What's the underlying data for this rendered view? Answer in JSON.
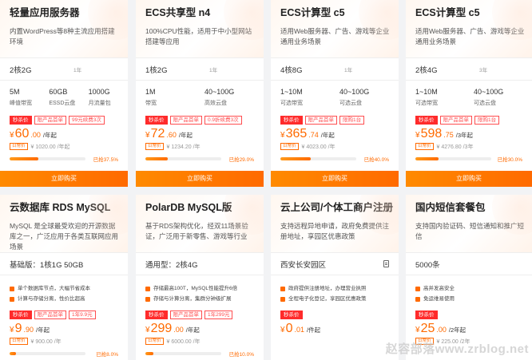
{
  "cards_row1": [
    {
      "title": "轻量应用服务器",
      "desc": "内置WordPress等8种主流应用搭建环境",
      "spec": "2核2G",
      "spec_sub": "1年",
      "metrics": [
        {
          "v": "5M",
          "l": "峰值带宽"
        },
        {
          "v": "60GB",
          "l": "ESSD云盘"
        },
        {
          "v": "1000G",
          "l": "月流量包"
        }
      ],
      "tags": [
        {
          "t": "秒杀价",
          "s": "solid"
        },
        {
          "t": "限产品首单",
          "s": "red"
        },
        {
          "t": "99元续费3次",
          "s": "red"
        }
      ],
      "price": {
        "sym": "¥",
        "num": "60",
        "dec": ".00",
        "unit": "/年起"
      },
      "daily": "日常价",
      "orig": "¥ 1020.00 /年起",
      "progress": 37.5,
      "sold": "已抢37.5%",
      "buy": "立即购买"
    },
    {
      "title": "ECS共享型 n4",
      "desc": "100%CPU性能，适用于中小型网站搭建等应用",
      "spec": "1核2G",
      "spec_sub": "1年",
      "metrics": [
        {
          "v": "1M",
          "l": "带宽"
        },
        {
          "v": "40~100G",
          "l": "高效云盘"
        }
      ],
      "tags": [
        {
          "t": "秒杀价",
          "s": "solid"
        },
        {
          "t": "限产品首单",
          "s": "red"
        },
        {
          "t": "0.9折续费3次",
          "s": "red"
        }
      ],
      "price": {
        "sym": "¥",
        "num": "72",
        "dec": ".60",
        "unit": "/年起"
      },
      "daily": "日常价",
      "orig": "¥ 1234.20 /年",
      "progress": 29.0,
      "sold": "已抢29.0%",
      "buy": "立即购买"
    },
    {
      "title": "ECS计算型 c5",
      "desc": "适用Web服务器、广告、游戏等企业通用业务场景",
      "spec": "4核8G",
      "spec_sub": "1年",
      "metrics": [
        {
          "v": "1~10M",
          "l": "可选带宽"
        },
        {
          "v": "40~100G",
          "l": "可选云盘"
        }
      ],
      "tags": [
        {
          "t": "秒杀价",
          "s": "solid"
        },
        {
          "t": "限产品首单",
          "s": "red"
        },
        {
          "t": "限购1台",
          "s": "red"
        }
      ],
      "price": {
        "sym": "¥",
        "num": "365",
        "dec": ".74",
        "unit": "/年起"
      },
      "daily": "日常价",
      "orig": "¥ 4023.00 /年",
      "progress": 40.0,
      "sold": "已抢40.0%",
      "buy": "立即购买"
    },
    {
      "title": "ECS计算型 c5",
      "desc": "适用Web服务器、广告、游戏等企业通用业务场景",
      "spec": "2核4G",
      "spec_sub": "3年",
      "metrics": [
        {
          "v": "1~10M",
          "l": "可选带宽"
        },
        {
          "v": "40~100G",
          "l": "可选云盘"
        }
      ],
      "tags": [
        {
          "t": "秒杀价",
          "s": "solid"
        },
        {
          "t": "限产品首单",
          "s": "red"
        },
        {
          "t": "限购1台",
          "s": "red"
        }
      ],
      "price": {
        "sym": "¥",
        "num": "598",
        "dec": ".75",
        "unit": "/3年起"
      },
      "daily": "日常价",
      "orig": "¥ 4276.80 /3年",
      "progress": 30.0,
      "sold": "已抢30.0%",
      "buy": "立即购买"
    }
  ],
  "cards_row2": [
    {
      "title": "云数据库 RDS MySQL",
      "desc": "MySQL 是全球最受欢迎的开源数据库之一，广泛应用于各类互联网应用场景",
      "spec": "基础版：1核1G 50GB",
      "bullets": [
        "单个数据库节点，大幅节省成本",
        "计算与存储分离，性价比超高"
      ],
      "tags": [
        {
          "t": "秒杀价",
          "s": "solid"
        },
        {
          "t": "限产品首单",
          "s": "red"
        },
        {
          "t": "1年9.9元",
          "s": "red"
        }
      ],
      "price": {
        "sym": "¥",
        "num": "9",
        "dec": ".90",
        "unit": "/年起"
      },
      "daily": "日常价",
      "orig": "¥ 900.00 /年",
      "progress": 8.0,
      "sold": "已抢8.0%"
    },
    {
      "title": "PolarDB MySQL版",
      "desc": "基于RDS架构优化，经双11场景验证，广泛用于新零售、游戏等行业",
      "spec": "通用型：2核4G",
      "bullets": [
        "存储最高100T，MySQL性能提升6倍",
        "存储与计算分离，集群分钟级扩展"
      ],
      "tags": [
        {
          "t": "秒杀价",
          "s": "solid"
        },
        {
          "t": "限产品首单",
          "s": "red"
        },
        {
          "t": "1年299元",
          "s": "red"
        }
      ],
      "price": {
        "sym": "¥",
        "num": "299",
        "dec": ".00",
        "unit": "/年起"
      },
      "daily": "日常价",
      "orig": "¥ 6000.00 /年",
      "progress": 10.0,
      "sold": "已抢10.0%"
    },
    {
      "title": "云上公司/个体工商户注册",
      "desc": "支持远程异地申请，政府免费提供注册地址，享园区优惠政策",
      "spec": "西安长安园区",
      "bullets": [
        "政府提供注册地址，办理营业执照",
        "全程电子化登记，享园区优惠政策"
      ],
      "tags": [
        {
          "t": "秒杀价",
          "s": "solid"
        }
      ],
      "price": {
        "sym": "¥",
        "num": "0",
        "dec": ".01",
        "unit": "/件起"
      },
      "daily": "",
      "orig": "",
      "progress": 0,
      "sold": ""
    },
    {
      "title": "国内短信套餐包",
      "desc": "支持国内验证码、短信通知和推广短信",
      "spec": "5000条",
      "bullets": [
        "高并发高安全",
        "免运维易使用"
      ],
      "tags": [
        {
          "t": "秒杀价",
          "s": "solid"
        }
      ],
      "price": {
        "sym": "¥",
        "num": "25",
        "dec": ".00",
        "unit": "/2年起"
      },
      "daily": "日常价",
      "orig": "¥ 225.00 /2年",
      "progress": 0,
      "sold": ""
    }
  ],
  "watermark": "赵容部落www.zrblog.net"
}
